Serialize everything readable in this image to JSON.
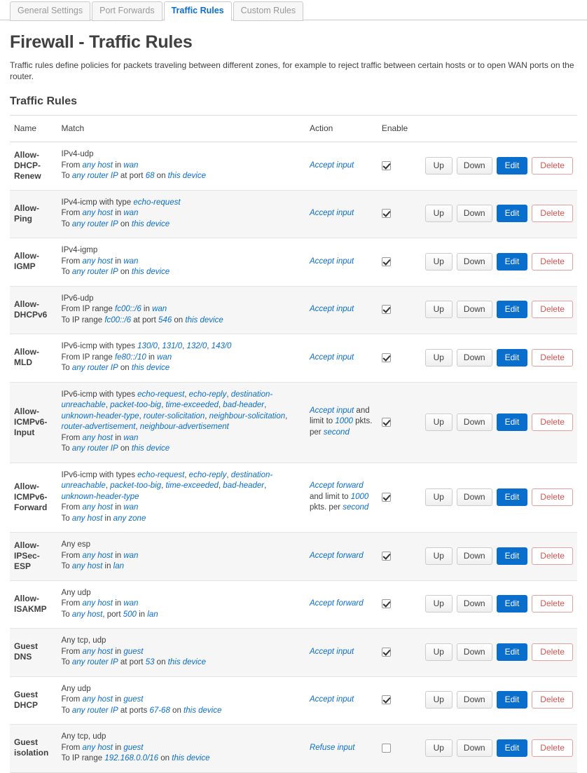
{
  "tabs": [
    {
      "label": "General Settings",
      "active": false
    },
    {
      "label": "Port Forwards",
      "active": false
    },
    {
      "label": "Traffic Rules",
      "active": true
    },
    {
      "label": "Custom Rules",
      "active": false
    }
  ],
  "page": {
    "title": "Firewall - Traffic Rules",
    "description": "Traffic rules define policies for packets traveling between different zones, for example to reject traffic between certain hosts or to open WAN ports on the router.",
    "section_title": "Traffic Rules"
  },
  "colors": {
    "link": "#0a6ecd",
    "edit_button_bg": "#0a6ecd",
    "delete_button_text": "#d9534f",
    "row_alt_bg": "#f6f6f6",
    "text": "#404040"
  },
  "table": {
    "headers": [
      "Name",
      "Match",
      "Action",
      "Enable",
      ""
    ],
    "buttons": {
      "up": "Up",
      "down": "Down",
      "edit": "Edit",
      "delete": "Delete"
    },
    "rows": [
      {
        "name": "Allow-DHCP-Renew",
        "match_lines": [
          [
            {
              "t": "IPv4-udp",
              "s": "plain"
            }
          ],
          [
            {
              "t": "From ",
              "s": "plain"
            },
            {
              "t": "any host",
              "s": "em"
            },
            {
              "t": " in ",
              "s": "plain"
            },
            {
              "t": "wan",
              "s": "em"
            }
          ],
          [
            {
              "t": "To ",
              "s": "plain"
            },
            {
              "t": "any router IP",
              "s": "em"
            },
            {
              "t": " at port ",
              "s": "plain"
            },
            {
              "t": "68",
              "s": "em"
            },
            {
              "t": " on ",
              "s": "plain"
            },
            {
              "t": "this device",
              "s": "em"
            }
          ]
        ],
        "action_parts": [
          {
            "t": "Accept input",
            "s": "em"
          }
        ],
        "enabled": true
      },
      {
        "name": "Allow-Ping",
        "match_lines": [
          [
            {
              "t": "IPv4-icmp with type ",
              "s": "plain"
            },
            {
              "t": "echo-request",
              "s": "em"
            }
          ],
          [
            {
              "t": "From ",
              "s": "plain"
            },
            {
              "t": "any host",
              "s": "em"
            },
            {
              "t": " in ",
              "s": "plain"
            },
            {
              "t": "wan",
              "s": "em"
            }
          ],
          [
            {
              "t": "To ",
              "s": "plain"
            },
            {
              "t": "any router IP",
              "s": "em"
            },
            {
              "t": " on ",
              "s": "plain"
            },
            {
              "t": "this device",
              "s": "em"
            }
          ]
        ],
        "action_parts": [
          {
            "t": "Accept input",
            "s": "em"
          }
        ],
        "enabled": true
      },
      {
        "name": "Allow-IGMP",
        "match_lines": [
          [
            {
              "t": "IPv4-igmp",
              "s": "plain"
            }
          ],
          [
            {
              "t": "From ",
              "s": "plain"
            },
            {
              "t": "any host",
              "s": "em"
            },
            {
              "t": " in ",
              "s": "plain"
            },
            {
              "t": "wan",
              "s": "em"
            }
          ],
          [
            {
              "t": "To ",
              "s": "plain"
            },
            {
              "t": "any router IP",
              "s": "em"
            },
            {
              "t": " on ",
              "s": "plain"
            },
            {
              "t": "this device",
              "s": "em"
            }
          ]
        ],
        "action_parts": [
          {
            "t": "Accept input",
            "s": "em"
          }
        ],
        "enabled": true
      },
      {
        "name": "Allow-DHCPv6",
        "match_lines": [
          [
            {
              "t": "IPv6-udp",
              "s": "plain"
            }
          ],
          [
            {
              "t": "From IP range ",
              "s": "plain"
            },
            {
              "t": "fc00::/6",
              "s": "em"
            },
            {
              "t": " in ",
              "s": "plain"
            },
            {
              "t": "wan",
              "s": "em"
            }
          ],
          [
            {
              "t": "To IP range ",
              "s": "plain"
            },
            {
              "t": "fc00::/6",
              "s": "em"
            },
            {
              "t": " at port ",
              "s": "plain"
            },
            {
              "t": "546",
              "s": "em"
            },
            {
              "t": " on ",
              "s": "plain"
            },
            {
              "t": "this device",
              "s": "em"
            }
          ]
        ],
        "action_parts": [
          {
            "t": "Accept input",
            "s": "em"
          }
        ],
        "enabled": true
      },
      {
        "name": "Allow-MLD",
        "match_lines": [
          [
            {
              "t": "IPv6-icmp with types ",
              "s": "plain"
            },
            {
              "t": "130/0",
              "s": "em"
            },
            {
              "t": ", ",
              "s": "plain"
            },
            {
              "t": "131/0",
              "s": "em"
            },
            {
              "t": ", ",
              "s": "plain"
            },
            {
              "t": "132/0",
              "s": "em"
            },
            {
              "t": ", ",
              "s": "plain"
            },
            {
              "t": "143/0",
              "s": "em"
            }
          ],
          [
            {
              "t": "From IP range ",
              "s": "plain"
            },
            {
              "t": "fe80::/10",
              "s": "em"
            },
            {
              "t": " in ",
              "s": "plain"
            },
            {
              "t": "wan",
              "s": "em"
            }
          ],
          [
            {
              "t": "To ",
              "s": "plain"
            },
            {
              "t": "any router IP",
              "s": "em"
            },
            {
              "t": " on ",
              "s": "plain"
            },
            {
              "t": "this device",
              "s": "em"
            }
          ]
        ],
        "action_parts": [
          {
            "t": "Accept input",
            "s": "em"
          }
        ],
        "enabled": true
      },
      {
        "name": "Allow-ICMPv6-Input",
        "match_lines": [
          [
            {
              "t": "IPv6-icmp with types ",
              "s": "plain"
            },
            {
              "t": "echo-request",
              "s": "em"
            },
            {
              "t": ", ",
              "s": "plain"
            },
            {
              "t": "echo-reply",
              "s": "em"
            },
            {
              "t": ", ",
              "s": "plain"
            },
            {
              "t": "destination-unreachable",
              "s": "em"
            },
            {
              "t": ", ",
              "s": "plain"
            },
            {
              "t": "packet-too-big",
              "s": "em"
            },
            {
              "t": ", ",
              "s": "plain"
            },
            {
              "t": "time-exceeded",
              "s": "em"
            },
            {
              "t": ", ",
              "s": "plain"
            },
            {
              "t": "bad-header",
              "s": "em"
            },
            {
              "t": ", ",
              "s": "plain"
            },
            {
              "t": "unknown-header-type",
              "s": "em"
            },
            {
              "t": ", ",
              "s": "plain"
            },
            {
              "t": "router-solicitation",
              "s": "em"
            },
            {
              "t": ", ",
              "s": "plain"
            },
            {
              "t": "neighbour-solicitation",
              "s": "em"
            },
            {
              "t": ", ",
              "s": "plain"
            },
            {
              "t": "router-advertisement",
              "s": "em"
            },
            {
              "t": ", ",
              "s": "plain"
            },
            {
              "t": "neighbour-advertisement",
              "s": "em"
            }
          ],
          [
            {
              "t": "From ",
              "s": "plain"
            },
            {
              "t": "any host",
              "s": "em"
            },
            {
              "t": " in ",
              "s": "plain"
            },
            {
              "t": "wan",
              "s": "em"
            }
          ],
          [
            {
              "t": "To ",
              "s": "plain"
            },
            {
              "t": "any router IP",
              "s": "em"
            },
            {
              "t": " on ",
              "s": "plain"
            },
            {
              "t": "this device",
              "s": "em"
            }
          ]
        ],
        "action_parts": [
          {
            "t": "Accept input",
            "s": "em"
          },
          {
            "t": " and limit to ",
            "s": "plain"
          },
          {
            "t": "1000",
            "s": "em"
          },
          {
            "t": " pkts. per ",
            "s": "plain"
          },
          {
            "t": "second",
            "s": "em"
          }
        ],
        "enabled": true
      },
      {
        "name": "Allow-ICMPv6-Forward",
        "match_lines": [
          [
            {
              "t": "IPv6-icmp with types ",
              "s": "plain"
            },
            {
              "t": "echo-request",
              "s": "em"
            },
            {
              "t": ", ",
              "s": "plain"
            },
            {
              "t": "echo-reply",
              "s": "em"
            },
            {
              "t": ", ",
              "s": "plain"
            },
            {
              "t": "destination-unreachable",
              "s": "em"
            },
            {
              "t": ", ",
              "s": "plain"
            },
            {
              "t": "packet-too-big",
              "s": "em"
            },
            {
              "t": ", ",
              "s": "plain"
            },
            {
              "t": "time-exceeded",
              "s": "em"
            },
            {
              "t": ", ",
              "s": "plain"
            },
            {
              "t": "bad-header",
              "s": "em"
            },
            {
              "t": ", ",
              "s": "plain"
            },
            {
              "t": "unknown-header-type",
              "s": "em"
            }
          ],
          [
            {
              "t": "From ",
              "s": "plain"
            },
            {
              "t": "any host",
              "s": "em"
            },
            {
              "t": " in ",
              "s": "plain"
            },
            {
              "t": "wan",
              "s": "em"
            }
          ],
          [
            {
              "t": "To ",
              "s": "plain"
            },
            {
              "t": "any host",
              "s": "em"
            },
            {
              "t": " in ",
              "s": "plain"
            },
            {
              "t": "any zone",
              "s": "em"
            }
          ]
        ],
        "action_parts": [
          {
            "t": "Accept forward",
            "s": "em"
          },
          {
            "t": " and limit to ",
            "s": "plain"
          },
          {
            "t": "1000",
            "s": "em"
          },
          {
            "t": " pkts. per ",
            "s": "plain"
          },
          {
            "t": "second",
            "s": "em"
          }
        ],
        "enabled": true
      },
      {
        "name": "Allow-IPSec-ESP",
        "match_lines": [
          [
            {
              "t": "Any esp",
              "s": "plain"
            }
          ],
          [
            {
              "t": "From ",
              "s": "plain"
            },
            {
              "t": "any host",
              "s": "em"
            },
            {
              "t": " in ",
              "s": "plain"
            },
            {
              "t": "wan",
              "s": "em"
            }
          ],
          [
            {
              "t": "To ",
              "s": "plain"
            },
            {
              "t": "any host",
              "s": "em"
            },
            {
              "t": " in ",
              "s": "plain"
            },
            {
              "t": "lan",
              "s": "em"
            }
          ]
        ],
        "action_parts": [
          {
            "t": "Accept forward",
            "s": "em"
          }
        ],
        "enabled": true
      },
      {
        "name": "Allow-ISAKMP",
        "match_lines": [
          [
            {
              "t": "Any udp",
              "s": "plain"
            }
          ],
          [
            {
              "t": "From ",
              "s": "plain"
            },
            {
              "t": "any host",
              "s": "em"
            },
            {
              "t": " in ",
              "s": "plain"
            },
            {
              "t": "wan",
              "s": "em"
            }
          ],
          [
            {
              "t": "To ",
              "s": "plain"
            },
            {
              "t": "any host",
              "s": "em"
            },
            {
              "t": ", port ",
              "s": "plain"
            },
            {
              "t": "500",
              "s": "em"
            },
            {
              "t": " in ",
              "s": "plain"
            },
            {
              "t": "lan",
              "s": "em"
            }
          ]
        ],
        "action_parts": [
          {
            "t": "Accept forward",
            "s": "em"
          }
        ],
        "enabled": true
      },
      {
        "name": "Guest DNS",
        "match_lines": [
          [
            {
              "t": "Any tcp, udp",
              "s": "plain"
            }
          ],
          [
            {
              "t": "From ",
              "s": "plain"
            },
            {
              "t": "any host",
              "s": "em"
            },
            {
              "t": " in ",
              "s": "plain"
            },
            {
              "t": "guest",
              "s": "em"
            }
          ],
          [
            {
              "t": "To ",
              "s": "plain"
            },
            {
              "t": "any router IP",
              "s": "em"
            },
            {
              "t": " at port ",
              "s": "plain"
            },
            {
              "t": "53",
              "s": "em"
            },
            {
              "t": " on ",
              "s": "plain"
            },
            {
              "t": "this device",
              "s": "em"
            }
          ]
        ],
        "action_parts": [
          {
            "t": "Accept input",
            "s": "em"
          }
        ],
        "enabled": true
      },
      {
        "name": "Guest DHCP",
        "match_lines": [
          [
            {
              "t": "Any udp",
              "s": "plain"
            }
          ],
          [
            {
              "t": "From ",
              "s": "plain"
            },
            {
              "t": "any host",
              "s": "em"
            },
            {
              "t": " in ",
              "s": "plain"
            },
            {
              "t": "guest",
              "s": "em"
            }
          ],
          [
            {
              "t": "To ",
              "s": "plain"
            },
            {
              "t": "any router IP",
              "s": "em"
            },
            {
              "t": " at ports ",
              "s": "plain"
            },
            {
              "t": "67-68",
              "s": "em"
            },
            {
              "t": " on ",
              "s": "plain"
            },
            {
              "t": "this device",
              "s": "em"
            }
          ]
        ],
        "action_parts": [
          {
            "t": "Accept input",
            "s": "em"
          }
        ],
        "enabled": true
      },
      {
        "name": "Guest isolation",
        "match_lines": [
          [
            {
              "t": "Any tcp, udp",
              "s": "plain"
            }
          ],
          [
            {
              "t": "From ",
              "s": "plain"
            },
            {
              "t": "any host",
              "s": "em"
            },
            {
              "t": " in ",
              "s": "plain"
            },
            {
              "t": "guest",
              "s": "em"
            }
          ],
          [
            {
              "t": "To IP range ",
              "s": "plain"
            },
            {
              "t": "192.168.0.0/16",
              "s": "em"
            },
            {
              "t": " on ",
              "s": "plain"
            },
            {
              "t": "this device",
              "s": "em"
            }
          ]
        ],
        "action_parts": [
          {
            "t": "Refuse input",
            "s": "em"
          }
        ],
        "enabled": false
      }
    ]
  }
}
